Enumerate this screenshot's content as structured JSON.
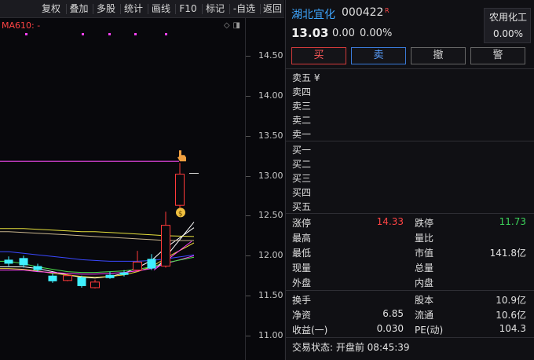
{
  "toolbar": {
    "items": [
      "复权",
      "叠加",
      "多股",
      "统计",
      "画线",
      "F10",
      "标记",
      "-自选",
      "返回"
    ]
  },
  "chart": {
    "ma_label": "MA610: -",
    "icons": [
      "diamond-icon",
      "panel-toggle-icon"
    ],
    "y_ticks": [
      "14.50",
      "14.00",
      "13.50",
      "13.00",
      "12.50",
      "12.00",
      "11.50",
      "11.00"
    ]
  },
  "chart_data": {
    "type": "candlestick",
    "yaxis_ticks": [
      14.5,
      14.0,
      13.5,
      13.0,
      12.5,
      12.0,
      11.5,
      11.0
    ],
    "ylim": [
      10.8,
      14.7
    ],
    "candles": [
      {
        "open": 11.9,
        "close": 11.95,
        "high": 11.99,
        "low": 11.87,
        "color": "cyan"
      },
      {
        "open": 11.97,
        "close": 11.88,
        "high": 12.0,
        "low": 11.85,
        "color": "cyan"
      },
      {
        "open": 11.87,
        "close": 11.82,
        "high": 11.9,
        "low": 11.8,
        "color": "cyan"
      },
      {
        "open": 11.75,
        "close": 11.68,
        "high": 11.78,
        "low": 11.66,
        "color": "cyan"
      },
      {
        "open": 11.69,
        "close": 11.75,
        "high": 11.78,
        "low": 11.68,
        "color": "red"
      },
      {
        "open": 11.73,
        "close": 11.62,
        "high": 11.75,
        "low": 11.6,
        "color": "cyan"
      },
      {
        "open": 11.6,
        "close": 11.67,
        "high": 11.7,
        "low": 11.59,
        "color": "red"
      },
      {
        "open": 11.72,
        "close": 11.76,
        "high": 11.8,
        "low": 11.71,
        "color": "cyan"
      },
      {
        "open": 11.76,
        "close": 11.79,
        "high": 11.82,
        "low": 11.74,
        "color": "cyan"
      },
      {
        "open": 11.82,
        "close": 11.92,
        "high": 12.06,
        "low": 11.8,
        "color": "red"
      },
      {
        "open": 11.84,
        "close": 11.96,
        "high": 12.02,
        "low": 11.82,
        "color": "cyan"
      },
      {
        "open": 11.87,
        "close": 12.38,
        "high": 12.55,
        "low": 11.85,
        "color": "red"
      },
      {
        "open": 12.63,
        "close": 13.02,
        "high": 13.16,
        "low": 12.55,
        "color": "red"
      }
    ],
    "series": [
      {
        "values": [
          11.86,
          11.86,
          11.84,
          11.8,
          11.76,
          11.73,
          11.72,
          11.74,
          11.78,
          11.85,
          11.94,
          12.1,
          12.35
        ],
        "color": "#ffffff"
      },
      {
        "values": [
          11.84,
          11.83,
          11.81,
          11.78,
          11.76,
          11.74,
          11.73,
          11.74,
          11.76,
          11.8,
          11.86,
          11.97,
          12.16
        ],
        "color": "#e8d23c"
      },
      {
        "values": [
          11.82,
          11.82,
          11.8,
          11.79,
          11.78,
          11.77,
          11.77,
          11.78,
          11.79,
          11.81,
          11.84,
          11.9,
          12.0
        ],
        "color": "#ff40ff"
      },
      {
        "values": [
          11.93,
          11.9,
          11.86,
          11.83,
          11.8,
          11.79,
          11.79,
          11.8,
          11.81,
          11.83,
          11.86,
          11.91,
          11.98
        ],
        "color": "#4cdc4c"
      },
      {
        "values": [
          12.05,
          12.03,
          12.01,
          11.99,
          11.97,
          11.95,
          11.94,
          11.93,
          11.93,
          11.93,
          11.94,
          11.96,
          12.01
        ],
        "color": "#3a48ff"
      },
      {
        "values": [
          12.3,
          12.29,
          12.28,
          12.27,
          12.26,
          12.25,
          12.24,
          12.23,
          12.22,
          12.21,
          12.2,
          12.19,
          12.19
        ],
        "color": "#c8b48c"
      },
      {
        "values": [
          12.34,
          12.34,
          12.33,
          12.32,
          12.31,
          12.3,
          12.3,
          12.29,
          12.28,
          12.27,
          12.26,
          12.25,
          12.24
        ],
        "color": "#e6e03c"
      }
    ],
    "limit_up_line": 13.18,
    "price_marker": 13.03
  },
  "quote": {
    "name": "湖北宜化",
    "code": "000422",
    "badge": "R",
    "industry_name": "农用化工",
    "industry_pct": "0.00%",
    "price": "13.03",
    "change": "0.00",
    "change_pct": "0.00%",
    "buttons": {
      "buy": "买",
      "sell": "卖",
      "cancel": "撤",
      "alert": "警"
    },
    "ask_labels": [
      "卖五 ¥",
      "卖四",
      "卖三",
      "卖二",
      "卖一"
    ],
    "bid_labels": [
      "买一",
      "买二",
      "买三",
      "买四",
      "买五"
    ],
    "stats_left": [
      {
        "label": "涨停",
        "value": "14.33",
        "color": "red"
      },
      {
        "label": "最高",
        "value": ""
      },
      {
        "label": "最低",
        "value": ""
      },
      {
        "label": "现量",
        "value": ""
      },
      {
        "label": "外盘",
        "value": ""
      }
    ],
    "stats_right": [
      {
        "label": "跌停",
        "value": "11.73",
        "color": "green"
      },
      {
        "label": "量比",
        "value": ""
      },
      {
        "label": "市值",
        "value": "141.8亿"
      },
      {
        "label": "总量",
        "value": ""
      },
      {
        "label": "内盘",
        "value": ""
      }
    ],
    "fin_left": [
      {
        "label": "换手",
        "value": ""
      },
      {
        "label": "净资",
        "value": "6.85"
      },
      {
        "label": "收益(一)",
        "value": "0.030"
      }
    ],
    "fin_right": [
      {
        "label": "股本",
        "value": "10.9亿"
      },
      {
        "label": "流通",
        "value": "10.6亿"
      },
      {
        "label": "PE(动)",
        "value": "104.3"
      }
    ],
    "trade_status": "交易状态: 开盘前 08:45:39"
  }
}
